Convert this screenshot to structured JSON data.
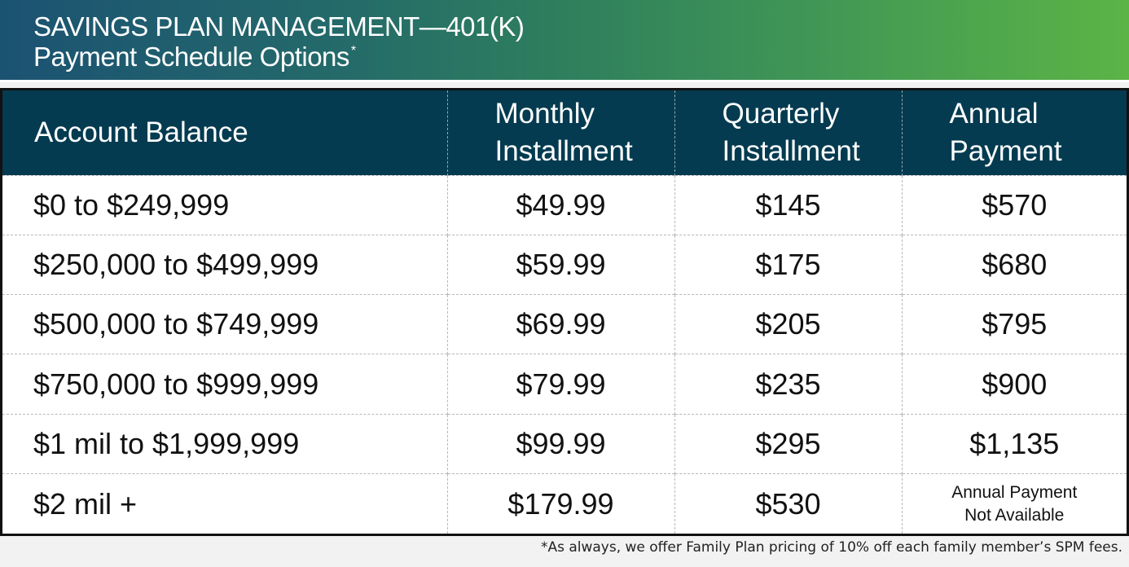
{
  "header": {
    "title": "SAVINGS PLAN MANAGEMENT—401(K)",
    "subtitle": "Payment Schedule Options",
    "subtitle_marker": "*"
  },
  "table": {
    "columns": [
      {
        "line1": "Account Balance",
        "line2": ""
      },
      {
        "line1": "Monthly",
        "line2": "Installment"
      },
      {
        "line1": "Quarterly",
        "line2": "Installment"
      },
      {
        "line1": "Annual",
        "line2": "Payment"
      }
    ],
    "rows": [
      {
        "balance": "$0 to $249,999",
        "monthly": "$49.99",
        "quarterly": "$145",
        "annual": "$570"
      },
      {
        "balance": "$250,000 to $499,999",
        "monthly": "$59.99",
        "quarterly": "$175",
        "annual": "$680"
      },
      {
        "balance": "$500,000 to $749,999",
        "monthly": "$69.99",
        "quarterly": "$205",
        "annual": "$795"
      },
      {
        "balance": "$750,000 to $999,999",
        "monthly": "$79.99",
        "quarterly": "$235",
        "annual": "$900"
      },
      {
        "balance": "$1 mil to $1,999,999",
        "monthly": "$99.99",
        "quarterly": "$295",
        "annual": "$1,135"
      },
      {
        "balance": "$2 mil +",
        "monthly": "$179.99",
        "quarterly": "$530",
        "annual_line1": "Annual Payment",
        "annual_line2": "Not Available"
      }
    ]
  },
  "footnote": "*As always, we offer Family Plan pricing of 10% off each family member’s SPM fees.",
  "colors": {
    "header_bg": "#043b50",
    "banner_start": "#1b5272",
    "banner_end": "#5bb446"
  }
}
